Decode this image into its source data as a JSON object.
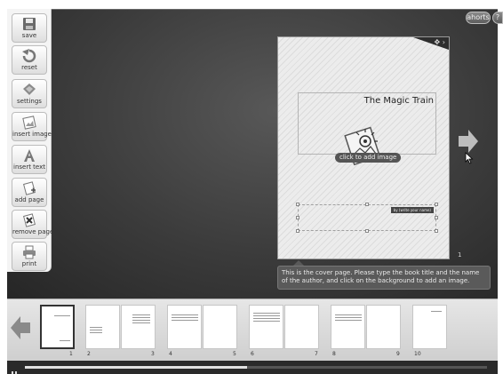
{
  "top_buttons": [
    {
      "label": "ahorts"
    },
    {
      "label": "?"
    }
  ],
  "toolbar": {
    "items": [
      {
        "label": "save",
        "icon": "floppy-disk-icon"
      },
      {
        "label": "reset",
        "icon": "undo-arrow-icon"
      },
      {
        "label": "settings",
        "icon": "diamond-settings-icon"
      },
      {
        "label": "insert image",
        "icon": "picture-icon"
      },
      {
        "label": "insert text",
        "icon": "letter-a-icon"
      },
      {
        "label": "add page",
        "icon": "page-plus-icon"
      },
      {
        "label": "remove page",
        "icon": "page-x-icon"
      },
      {
        "label": "print",
        "icon": "printer-icon"
      }
    ]
  },
  "page": {
    "title": "The Magic Train",
    "add_image_label": "click to add image",
    "author_placeholder": "by (write your name)",
    "number": "1"
  },
  "hint": {
    "text": "This is the cover page. Please type the book title and the name of the author, and click on the background to add an image."
  },
  "thumbnails": {
    "numbers": [
      "1",
      "2",
      "3",
      "4",
      "5",
      "6",
      "7",
      "8",
      "9",
      "10"
    ],
    "selected": "1"
  },
  "colors": {
    "stage_bg": "#3b3b3b",
    "toolbar_bg": "#f4f4f4",
    "hint_bg": "#5a5a5a"
  }
}
